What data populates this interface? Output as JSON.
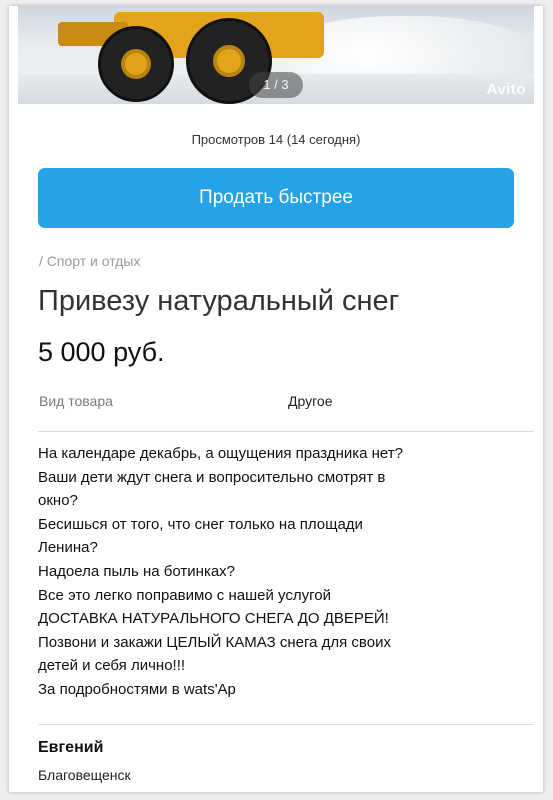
{
  "gallery": {
    "counter": "1 / 3",
    "watermark": "Avito"
  },
  "stats": {
    "views": "Просмотров 14 (14 сегодня)"
  },
  "actions": {
    "sell_faster": "Продать быстрее"
  },
  "listing": {
    "breadcrumb": "/ Спорт и отдых",
    "title": "Привезу натуральный снег",
    "price": "5 000 руб.",
    "properties": [
      {
        "label": "Вид товара",
        "value": "Другое"
      }
    ],
    "description": [
      "На календаре декабрь, а ощущения праздника нет?",
      "Ваши дети ждут снега и вопросительно смотрят в",
      "окно?",
      "Бесишься от того, что снег только на площади",
      "Ленина?",
      "Надоела пыль на ботинках?",
      "Все это легко поправимо с нашей услугой",
      "ДОСТАВКА НАТУРАЛЬНОГО СНЕГА ДО ДВЕРЕЙ!",
      "Позвони и закажи ЦЕЛЫЙ КАМАЗ снега для своих",
      "детей и себя лично!!!",
      "За подробностями в wats'Ap"
    ]
  },
  "seller": {
    "name": "Евгений",
    "city": "Благовещенск"
  },
  "colors": {
    "accent": "#24a3e8",
    "background": "#ffffff"
  }
}
